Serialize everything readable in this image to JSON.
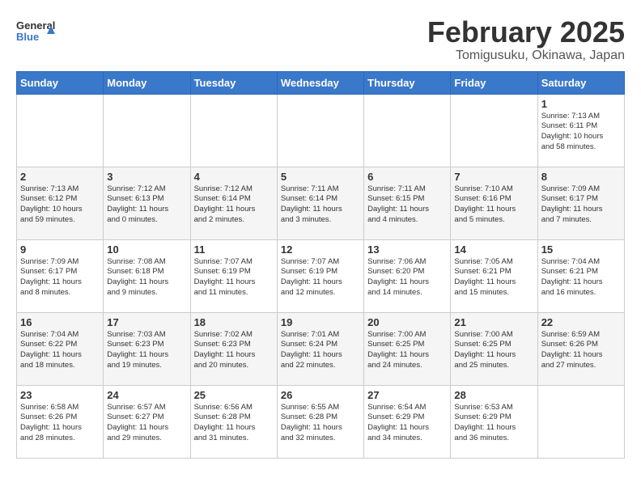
{
  "header": {
    "logo_line1": "General",
    "logo_line2": "Blue",
    "month_title": "February 2025",
    "location": "Tomigusuku, Okinawa, Japan"
  },
  "weekdays": [
    "Sunday",
    "Monday",
    "Tuesday",
    "Wednesday",
    "Thursday",
    "Friday",
    "Saturday"
  ],
  "weeks": [
    [
      {
        "day": "",
        "info": ""
      },
      {
        "day": "",
        "info": ""
      },
      {
        "day": "",
        "info": ""
      },
      {
        "day": "",
        "info": ""
      },
      {
        "day": "",
        "info": ""
      },
      {
        "day": "",
        "info": ""
      },
      {
        "day": "1",
        "info": "Sunrise: 7:13 AM\nSunset: 6:11 PM\nDaylight: 10 hours\nand 58 minutes."
      }
    ],
    [
      {
        "day": "2",
        "info": "Sunrise: 7:13 AM\nSunset: 6:12 PM\nDaylight: 10 hours\nand 59 minutes."
      },
      {
        "day": "3",
        "info": "Sunrise: 7:12 AM\nSunset: 6:13 PM\nDaylight: 11 hours\nand 0 minutes."
      },
      {
        "day": "4",
        "info": "Sunrise: 7:12 AM\nSunset: 6:14 PM\nDaylight: 11 hours\nand 2 minutes."
      },
      {
        "day": "5",
        "info": "Sunrise: 7:11 AM\nSunset: 6:14 PM\nDaylight: 11 hours\nand 3 minutes."
      },
      {
        "day": "6",
        "info": "Sunrise: 7:11 AM\nSunset: 6:15 PM\nDaylight: 11 hours\nand 4 minutes."
      },
      {
        "day": "7",
        "info": "Sunrise: 7:10 AM\nSunset: 6:16 PM\nDaylight: 11 hours\nand 5 minutes."
      },
      {
        "day": "8",
        "info": "Sunrise: 7:09 AM\nSunset: 6:17 PM\nDaylight: 11 hours\nand 7 minutes."
      }
    ],
    [
      {
        "day": "9",
        "info": "Sunrise: 7:09 AM\nSunset: 6:17 PM\nDaylight: 11 hours\nand 8 minutes."
      },
      {
        "day": "10",
        "info": "Sunrise: 7:08 AM\nSunset: 6:18 PM\nDaylight: 11 hours\nand 9 minutes."
      },
      {
        "day": "11",
        "info": "Sunrise: 7:07 AM\nSunset: 6:19 PM\nDaylight: 11 hours\nand 11 minutes."
      },
      {
        "day": "12",
        "info": "Sunrise: 7:07 AM\nSunset: 6:19 PM\nDaylight: 11 hours\nand 12 minutes."
      },
      {
        "day": "13",
        "info": "Sunrise: 7:06 AM\nSunset: 6:20 PM\nDaylight: 11 hours\nand 14 minutes."
      },
      {
        "day": "14",
        "info": "Sunrise: 7:05 AM\nSunset: 6:21 PM\nDaylight: 11 hours\nand 15 minutes."
      },
      {
        "day": "15",
        "info": "Sunrise: 7:04 AM\nSunset: 6:21 PM\nDaylight: 11 hours\nand 16 minutes."
      }
    ],
    [
      {
        "day": "16",
        "info": "Sunrise: 7:04 AM\nSunset: 6:22 PM\nDaylight: 11 hours\nand 18 minutes."
      },
      {
        "day": "17",
        "info": "Sunrise: 7:03 AM\nSunset: 6:23 PM\nDaylight: 11 hours\nand 19 minutes."
      },
      {
        "day": "18",
        "info": "Sunrise: 7:02 AM\nSunset: 6:23 PM\nDaylight: 11 hours\nand 20 minutes."
      },
      {
        "day": "19",
        "info": "Sunrise: 7:01 AM\nSunset: 6:24 PM\nDaylight: 11 hours\nand 22 minutes."
      },
      {
        "day": "20",
        "info": "Sunrise: 7:00 AM\nSunset: 6:25 PM\nDaylight: 11 hours\nand 24 minutes."
      },
      {
        "day": "21",
        "info": "Sunrise: 7:00 AM\nSunset: 6:25 PM\nDaylight: 11 hours\nand 25 minutes."
      },
      {
        "day": "22",
        "info": "Sunrise: 6:59 AM\nSunset: 6:26 PM\nDaylight: 11 hours\nand 27 minutes."
      }
    ],
    [
      {
        "day": "23",
        "info": "Sunrise: 6:58 AM\nSunset: 6:26 PM\nDaylight: 11 hours\nand 28 minutes."
      },
      {
        "day": "24",
        "info": "Sunrise: 6:57 AM\nSunset: 6:27 PM\nDaylight: 11 hours\nand 29 minutes."
      },
      {
        "day": "25",
        "info": "Sunrise: 6:56 AM\nSunset: 6:28 PM\nDaylight: 11 hours\nand 31 minutes."
      },
      {
        "day": "26",
        "info": "Sunrise: 6:55 AM\nSunset: 6:28 PM\nDaylight: 11 hours\nand 32 minutes."
      },
      {
        "day": "27",
        "info": "Sunrise: 6:54 AM\nSunset: 6:29 PM\nDaylight: 11 hours\nand 34 minutes."
      },
      {
        "day": "28",
        "info": "Sunrise: 6:53 AM\nSunset: 6:29 PM\nDaylight: 11 hours\nand 36 minutes."
      },
      {
        "day": "",
        "info": ""
      }
    ]
  ]
}
